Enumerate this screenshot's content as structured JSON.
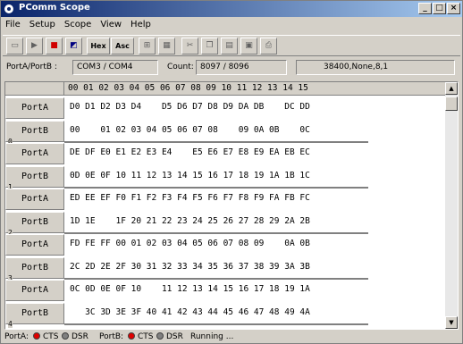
{
  "window": {
    "title": "PComm Scope",
    "controls": [
      "_",
      "□",
      "×"
    ]
  },
  "menu": [
    "File",
    "Setup",
    "Scope",
    "View",
    "Help"
  ],
  "toolbar": {
    "hex_label": "Hex",
    "asc_label": "Asc"
  },
  "info": {
    "port_label": "PortA/PortB :",
    "port_value": "COM3 / COM4",
    "count_label": "Count:",
    "count_value": "8097 / 8096",
    "settings_value": "38400,None,8,1"
  },
  "grid": {
    "header": "00 01 02 03 04 05 06 07 08 09 10 11 12 13 14 15",
    "rows": [
      {
        "port": "PortA",
        "idx": "",
        "data": "D0 D1 D2 D3 D4    D5 D6 D7 D8 D9 DA DB    DC DD"
      },
      {
        "port": "PortB",
        "idx": "0",
        "data": "00    01 02 03 04 05 06 07 08    09 0A 0B    0C"
      },
      {
        "port": "PortA",
        "idx": "",
        "data": "DE DF E0 E1 E2 E3 E4    E5 E6 E7 E8 E9 EA EB EC"
      },
      {
        "port": "PortB",
        "idx": "1",
        "data": "0D 0E 0F 10 11 12 13 14 15 16 17 18 19 1A 1B 1C"
      },
      {
        "port": "PortA",
        "idx": "",
        "data": "ED EE EF F0 F1 F2 F3 F4 F5 F6 F7 F8 F9 FA FB FC"
      },
      {
        "port": "PortB",
        "idx": "2",
        "data": "1D 1E    1F 20 21 22 23 24 25 26 27 28 29 2A 2B"
      },
      {
        "port": "PortA",
        "idx": "",
        "data": "FD FE FF 00 01 02 03 04 05 06 07 08 09    0A 0B"
      },
      {
        "port": "PortB",
        "idx": "3",
        "data": "2C 2D 2E 2F 30 31 32 33 34 35 36 37 38 39 3A 3B"
      },
      {
        "port": "PortA",
        "idx": "",
        "data": "0C 0D 0E 0F 10    11 12 13 14 15 16 17 18 19 1A"
      },
      {
        "port": "PortB",
        "idx": "4",
        "data": "   3C 3D 3E 3F 40 41 42 43 44 45 46 47 48 49 4A"
      }
    ]
  },
  "status": {
    "porta_label": "PortA:",
    "cts_label": "CTS",
    "dsr_label": "DSR",
    "portb_label": "PortB:",
    "running_text": "Running ...",
    "colors": {
      "cts_on": "#e00000",
      "dsr_off": "#808080"
    }
  }
}
